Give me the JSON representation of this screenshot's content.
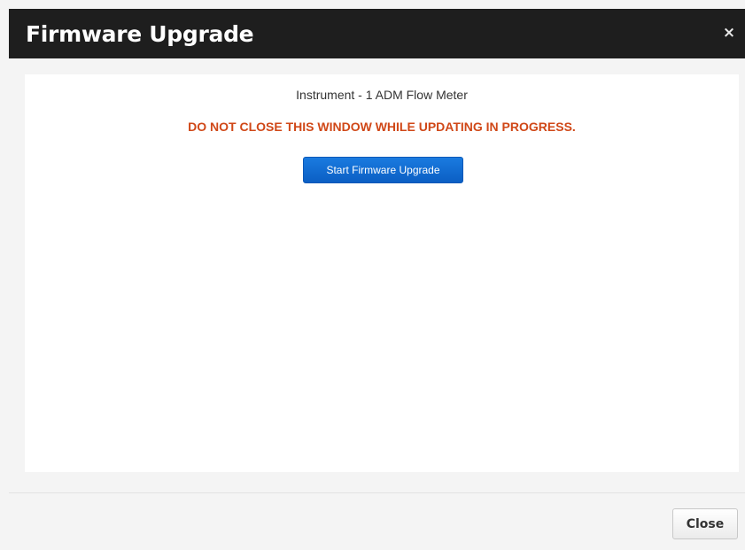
{
  "dialog": {
    "title": "Firmware Upgrade",
    "close_icon_glyph": "×"
  },
  "body": {
    "instrument_label": "Instrument - 1 ADM Flow Meter",
    "warning": "DO NOT CLOSE THIS WINDOW WHILE UPDATING IN PROGRESS.",
    "start_button_label": "Start Firmware Upgrade"
  },
  "footer": {
    "close_button_label": "Close"
  },
  "colors": {
    "header_bg": "#1e1e1e",
    "warning": "#d04818",
    "primary_button": "#0b5fc4"
  }
}
